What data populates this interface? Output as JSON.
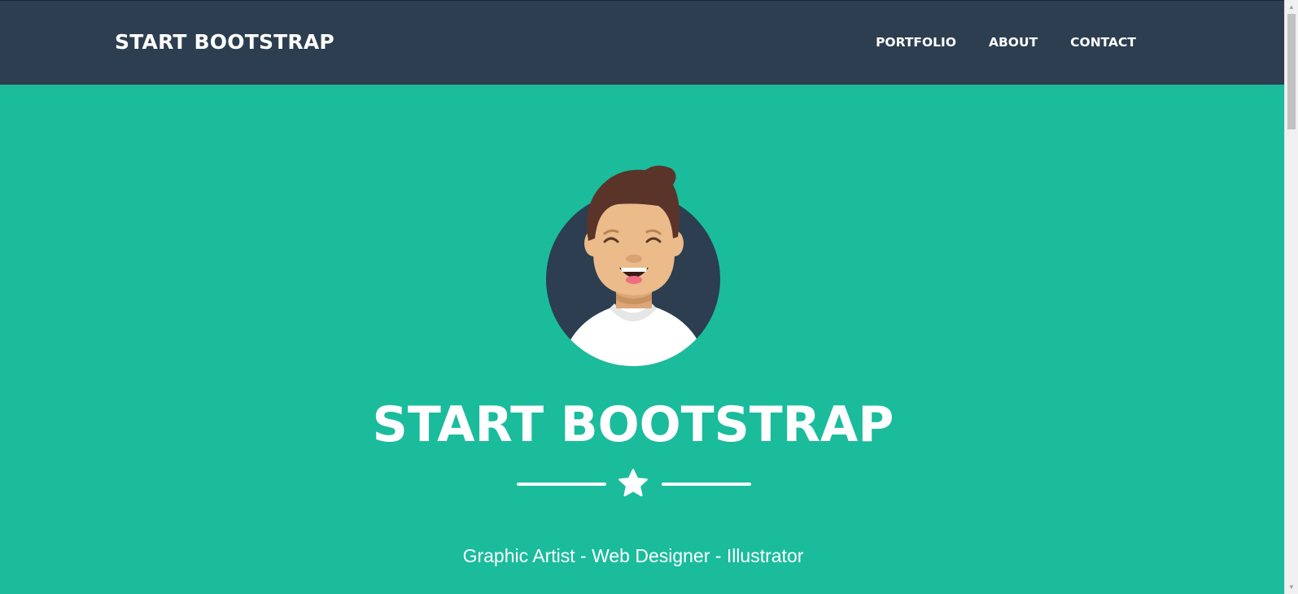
{
  "navbar": {
    "brand": "START BOOTSTRAP",
    "links": [
      {
        "label": "PORTFOLIO"
      },
      {
        "label": "ABOUT"
      },
      {
        "label": "CONTACT"
      }
    ]
  },
  "masthead": {
    "avatar_icon": "avatar-illustration",
    "title": "START BOOTSTRAP",
    "divider_icon": "star-icon",
    "subheading": "Graphic Artist - Web Designer - Illustrator"
  },
  "colors": {
    "navbar_bg": "#2c3e50",
    "masthead_bg": "#1abc9c",
    "text": "#ffffff"
  }
}
